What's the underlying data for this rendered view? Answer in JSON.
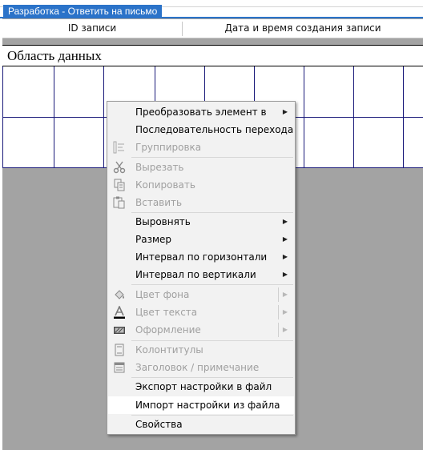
{
  "window": {
    "tab_title": "Разработка - Ответить на письмо"
  },
  "header": {
    "columns": [
      "ID записи",
      "Дата и время создания записи"
    ]
  },
  "section": {
    "title": "Область данных"
  },
  "context_menu": {
    "items": [
      {
        "label": "Преобразовать элемент в",
        "enabled": true,
        "submenu": true
      },
      {
        "label": "Последовательность перехода",
        "enabled": true,
        "submenu": false
      },
      {
        "label": "Группировка",
        "enabled": false,
        "submenu": false,
        "icon": "group-icon"
      },
      {
        "label": "Вырезать",
        "enabled": false,
        "submenu": false,
        "icon": "scissors-icon"
      },
      {
        "label": "Копировать",
        "enabled": false,
        "submenu": false,
        "icon": "copy-icon"
      },
      {
        "label": "Вставить",
        "enabled": false,
        "submenu": false,
        "icon": "paste-icon"
      },
      {
        "label": "Выровнять",
        "enabled": true,
        "submenu": true
      },
      {
        "label": "Размер",
        "enabled": true,
        "submenu": true
      },
      {
        "label": "Интервал по горизонтали",
        "enabled": true,
        "submenu": true
      },
      {
        "label": "Интервал по вертикали",
        "enabled": true,
        "submenu": true
      },
      {
        "label": "Цвет фона",
        "enabled": false,
        "submenu": true,
        "icon": "fill-color-icon"
      },
      {
        "label": "Цвет текста",
        "enabled": false,
        "submenu": true,
        "icon": "font-color-icon"
      },
      {
        "label": "Оформление",
        "enabled": false,
        "submenu": true,
        "icon": "special-effect-icon"
      },
      {
        "label": "Колонтитулы",
        "enabled": false,
        "submenu": false,
        "icon": "page-header-icon"
      },
      {
        "label": "Заголовок / примечание",
        "enabled": false,
        "submenu": false,
        "icon": "form-header-icon"
      },
      {
        "label": "Экспорт настройки в файл",
        "enabled": true,
        "submenu": false
      },
      {
        "label": "Импорт настройки из файла",
        "enabled": true,
        "submenu": false,
        "highlighted": true
      },
      {
        "label": "Свойства",
        "enabled": true,
        "submenu": false
      }
    ]
  },
  "colors": {
    "accent": "#2b73c9",
    "workspace": "#a3a3a3",
    "grid_lines": "#1a1a7a",
    "menu_bg": "#f2f2f2",
    "disabled_text": "#a0a0a0"
  }
}
